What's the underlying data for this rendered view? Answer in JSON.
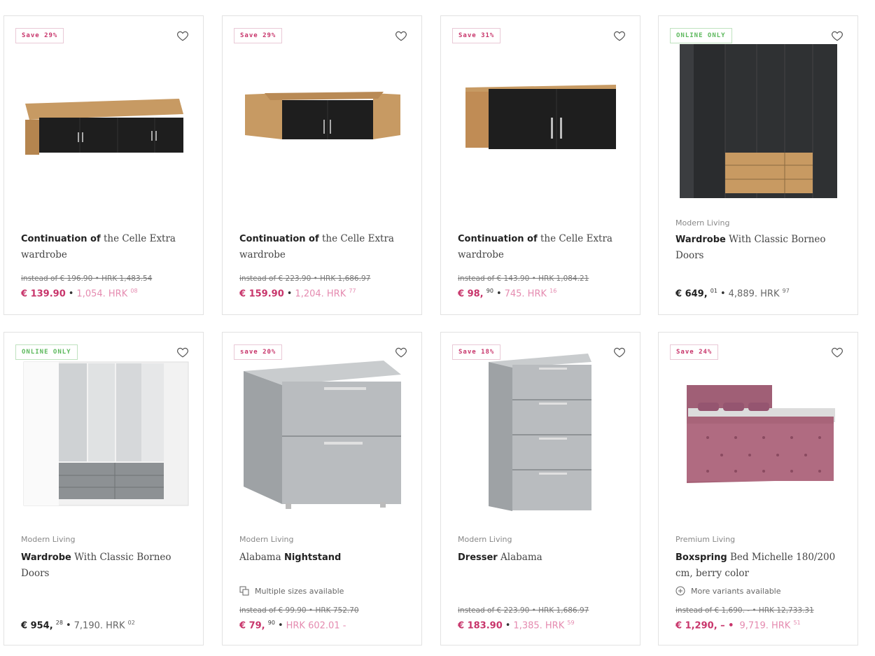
{
  "colors": {
    "sale": "#c8356b",
    "sale_light": "#e58bb0",
    "online": "#5cb85c"
  },
  "products": [
    {
      "badge": "Save 29%",
      "title_bold": "Continuation of",
      "title_rest": "the Celle Extra wardrobe",
      "old_price": "instead of € 196.90 • HRK 1,483.54",
      "price_main": "€ 139.90",
      "price_cents": "",
      "price_hrk": "1,054. HRK",
      "price_hrk_cents": "08"
    },
    {
      "badge": "Save 29%",
      "title_bold": "Continuation of",
      "title_rest": "the Celle Extra wardrobe",
      "old_price": "instead of € 223.90 • HRK 1,686.97",
      "price_main": "€ 159.90",
      "price_cents": "",
      "price_hrk": "1,204. HRK",
      "price_hrk_cents": "77"
    },
    {
      "badge": "Save 31%",
      "title_bold": "Continuation of",
      "title_rest": "the Celle Extra wardrobe",
      "old_price": "instead of € 143.90 • HRK 1,084.21",
      "price_main": "€ 98,",
      "price_cents": "90",
      "price_hrk": "745. HRK",
      "price_hrk_cents": "16"
    },
    {
      "badge": "ONLINE ONLY",
      "brand": "Modern Living",
      "title_bold": "Wardrobe",
      "title_rest": "With Classic Borneo Doors",
      "price_main": "€ 649,",
      "price_cents": "01",
      "price_hrk": "4,889. HRK",
      "price_hrk_cents": "97"
    },
    {
      "badge": "ONLINE ONLY",
      "brand": "Modern Living",
      "title_bold": "Wardrobe",
      "title_rest": "With Classic Borneo Doors",
      "price_main": "€ 954,",
      "price_cents": "28",
      "price_hrk": "7,190. HRK",
      "price_hrk_cents": "02"
    },
    {
      "badge": "save 20%",
      "brand": "Modern Living",
      "title_pre": "Alabama",
      "title_bold": "Nightstand",
      "variant": "Multiple sizes available",
      "old_price": "instead of € 99.90 • HRK 752.70",
      "price_main": "€ 79,",
      "price_cents": "90",
      "price_hrk": "HRK 602.01 -",
      "price_hrk_cents": ""
    },
    {
      "badge": "Save 18%",
      "brand": "Modern Living",
      "title_bold": "Dresser",
      "title_rest": "Alabama",
      "old_price": "instead of € 223.90 • HRK 1,686.97",
      "price_main": "€ 183.90",
      "price_cents": "",
      "price_hrk": "1,385. HRK",
      "price_hrk_cents": "59"
    },
    {
      "badge": "Save 24%",
      "brand": "Premium Living",
      "title_bold": "Boxspring",
      "title_rest": "Bed Michelle 180/200 cm, berry color",
      "variant": "More variants available",
      "old_price": "instead of € 1,690. - • HRK 12,733.31",
      "price_main": "€ 1,290, – •",
      "price_cents": "",
      "price_hrk": "9,719. HRK",
      "price_hrk_cents": "51"
    }
  ]
}
